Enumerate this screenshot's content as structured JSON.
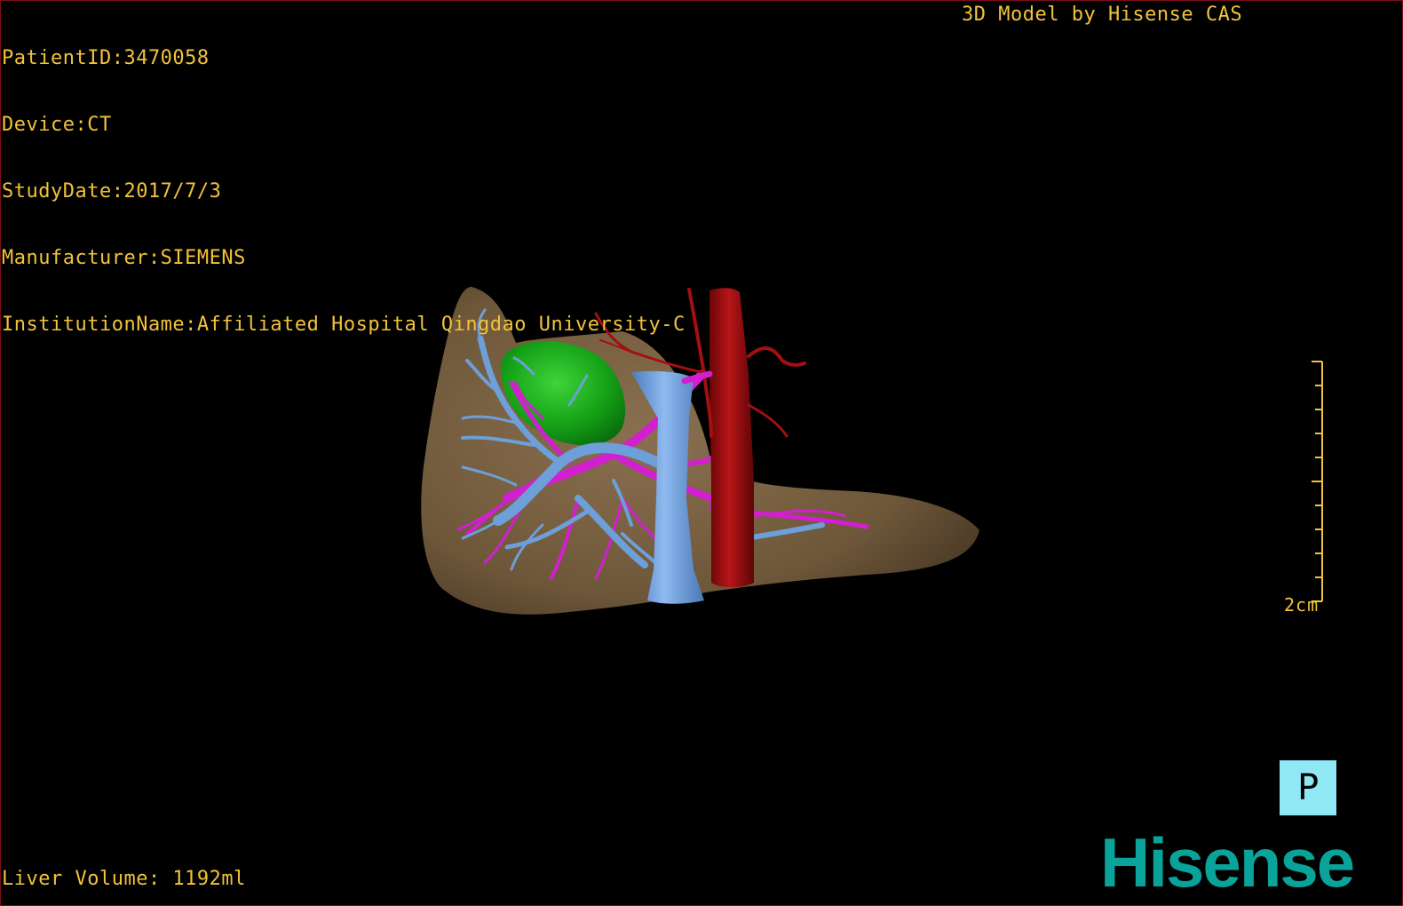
{
  "patient_info": {
    "patient_id": "PatientID:3470058",
    "device": "Device:CT",
    "study_date": "StudyDate:2017/7/3",
    "manufacturer": "Manufacturer:SIEMENS",
    "institution": "InstitutionName:Affiliated Hospital Qingdao University-C"
  },
  "credit": "3D Model by Hisense CAS",
  "scale_bar": {
    "label": "2cm"
  },
  "orientation_marker": "P",
  "liver_volume": "Liver Volume: 1192ml",
  "brand": "Hisense",
  "colors": {
    "overlay_text": "#f2c23a",
    "liver": "#7a6244",
    "portal_vein": "#6d9fd8",
    "hepatic_vessels": "#d21fd0",
    "aorta": "#a30f12",
    "tumor": "#18a81c",
    "orientation_cube": "#8fe8f4",
    "brand": "#0aa39a"
  }
}
